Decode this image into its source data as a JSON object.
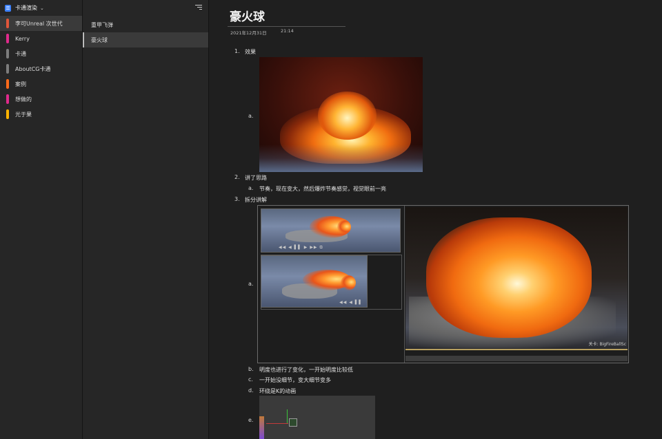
{
  "notebook": {
    "title": "卡通渲染",
    "chevron": "⌄"
  },
  "sections": [
    {
      "label": "李可Unreal 次世代",
      "color": "#e0563a",
      "active": true
    },
    {
      "label": "Kerry",
      "color": "#e02a8c",
      "active": false
    },
    {
      "label": "卡通",
      "color": "#7d7d7d",
      "active": false
    },
    {
      "label": "AboutCG卡通",
      "color": "#7d7d7d",
      "active": false
    },
    {
      "label": "案例",
      "color": "#ff6a1a",
      "active": false
    },
    {
      "label": "想做的",
      "color": "#e02a8c",
      "active": false
    },
    {
      "label": "光于果",
      "color": "#ffb300",
      "active": false
    }
  ],
  "pages": [
    {
      "label": "重甲飞弹",
      "active": false
    },
    {
      "label": "豪火球",
      "active": true
    }
  ],
  "page": {
    "title": "豪火球",
    "date": "2021年12月31日",
    "time": "21:14"
  },
  "outline": {
    "item1": {
      "num": "1.",
      "text": "效果",
      "sub_a": "a."
    },
    "item2": {
      "num": "2.",
      "text": "讲了思路",
      "sub_a_num": "a.",
      "sub_a_text": "节奏，现在变大，然后爆炸节奏感觉，视觉眼前一亮"
    },
    "item3": {
      "num": "3.",
      "text": "拆分讲解",
      "sub_a": "a.",
      "sub_b_num": "b.",
      "sub_b_text": "明度也进行了变化，一开始明度比较低",
      "sub_c_num": "c.",
      "sub_c_text": "一开始没细节，变大细节变多",
      "sub_d_num": "d.",
      "sub_d_text": "环绕是K的动画",
      "sub_e": "e."
    }
  },
  "media": {
    "thumb1_controls": "◀◀ ◀ ▌▌ ▶ ▶▶ ⧉",
    "thumb2_controls": "◀◀ ◀ ▌▌",
    "big_caption": "关卡: BigFireBallSc"
  }
}
